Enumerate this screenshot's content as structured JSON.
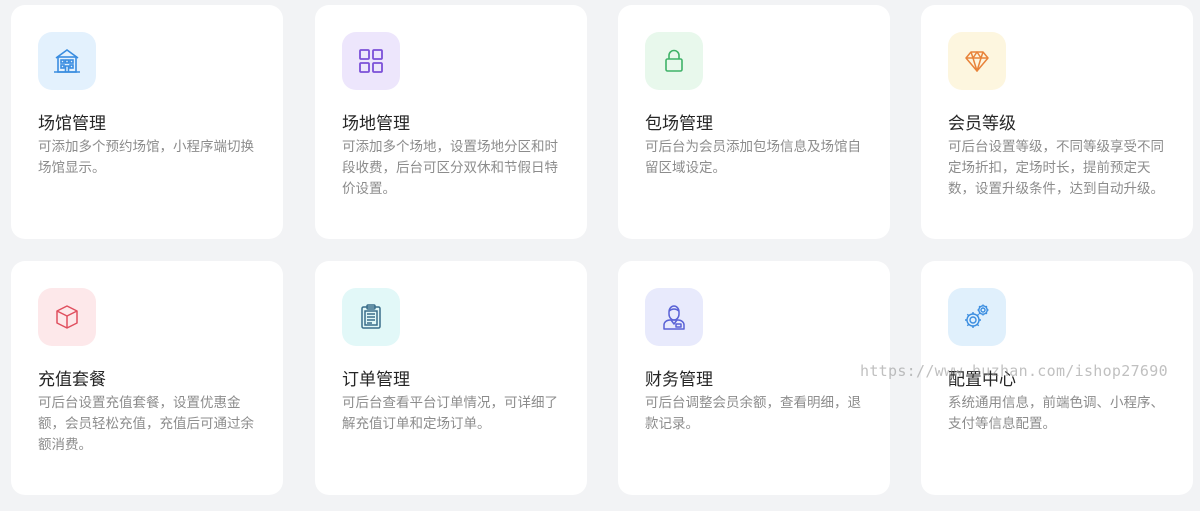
{
  "cards": [
    {
      "title": "场馆管理",
      "desc": "可添加多个预约场馆，小程序端切换场馆显示。",
      "icon": "building-icon",
      "icon_bg": "#e3f1fd",
      "icon_color": "#3a8de0"
    },
    {
      "title": "场地管理",
      "desc": "可添加多个场地，设置场地分区和时段收费，后台可区分双休和节假日特价设置。",
      "icon": "grid-icon",
      "icon_bg": "#ede6fc",
      "icon_color": "#7b4fd8"
    },
    {
      "title": "包场管理",
      "desc": "可后台为会员添加包场信息及场馆自留区域设定。",
      "icon": "lock-icon",
      "icon_bg": "#e8f8ec",
      "icon_color": "#3fb268"
    },
    {
      "title": "会员等级",
      "desc": "可后台设置等级，不同等级享受不同定场折扣，定场时长，提前预定天数，设置升级条件，达到自动升级。",
      "icon": "diamond-icon",
      "icon_bg": "#fdf6df",
      "icon_color": "#e8833a"
    },
    {
      "title": "充值套餐",
      "desc": "可后台设置充值套餐，设置优惠金额，会员轻松充值，充值后可通过余额消费。",
      "icon": "box-icon",
      "icon_bg": "#fde8ea",
      "icon_color": "#e0505f"
    },
    {
      "title": "订单管理",
      "desc": "可后台查看平台订单情况，可详细了解充值订单和定场订单。",
      "icon": "clipboard-icon",
      "icon_bg": "#e2f8f8",
      "icon_color": "#3a6e8a"
    },
    {
      "title": "财务管理",
      "desc": "可后台调整会员余额，查看明细，退款记录。",
      "icon": "user-icon",
      "icon_bg": "#e8eafc",
      "icon_color": "#5a63d6"
    },
    {
      "title": "配置中心",
      "desc": "系统通用信息，前端色调、小程序、支付等信息配置。",
      "icon": "gears-icon",
      "icon_bg": "#e0f0fc",
      "icon_color": "#3a8de0"
    }
  ],
  "watermark": "https://www.huzhan.com/ishop27690"
}
